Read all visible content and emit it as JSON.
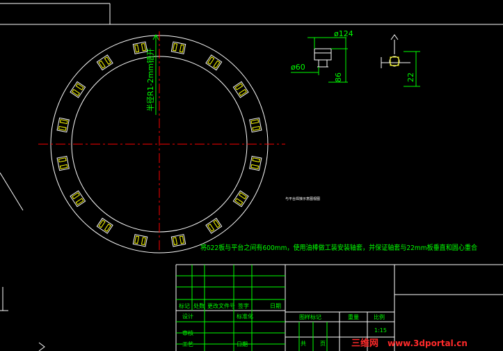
{
  "colors": {
    "background": "#000000",
    "linework": "#ffffff",
    "dimension": "#00ff00",
    "centerline": "#ff0000",
    "bracket": "#ffff00",
    "watermark": "#ff2a2a"
  },
  "ring": {
    "bracket_count": 16,
    "radius_label": "半径R1-2mm错开"
  },
  "part_detail": {
    "dim_top": "ø124",
    "dim_left": "ø60",
    "dim_height": "86"
  },
  "side_detail": {
    "dim_height": "22"
  },
  "notes": {
    "small_note": "与平台焊接示意图视图",
    "main_note": "将δ22板与平台之间有600mm，使用油棒做工装安装轴套，并保证轴套与22mm板垂直和圆心重合"
  },
  "title_block": {
    "col_labels": [
      "标记",
      "处数",
      "更改文件号",
      "签字",
      "日期"
    ],
    "row_design": "设计",
    "row_standard": "标准化",
    "row_check": "审核",
    "row_process": "工艺",
    "row_date": "日期",
    "stage_mark": "图样标记",
    "weight": "重量",
    "scale_label": "比例",
    "scale_value": "1:15",
    "sheet_total": "共",
    "sheet_unit": "页"
  },
  "watermark": {
    "brand": "三维网",
    "url": "www.3dportal.cn"
  }
}
